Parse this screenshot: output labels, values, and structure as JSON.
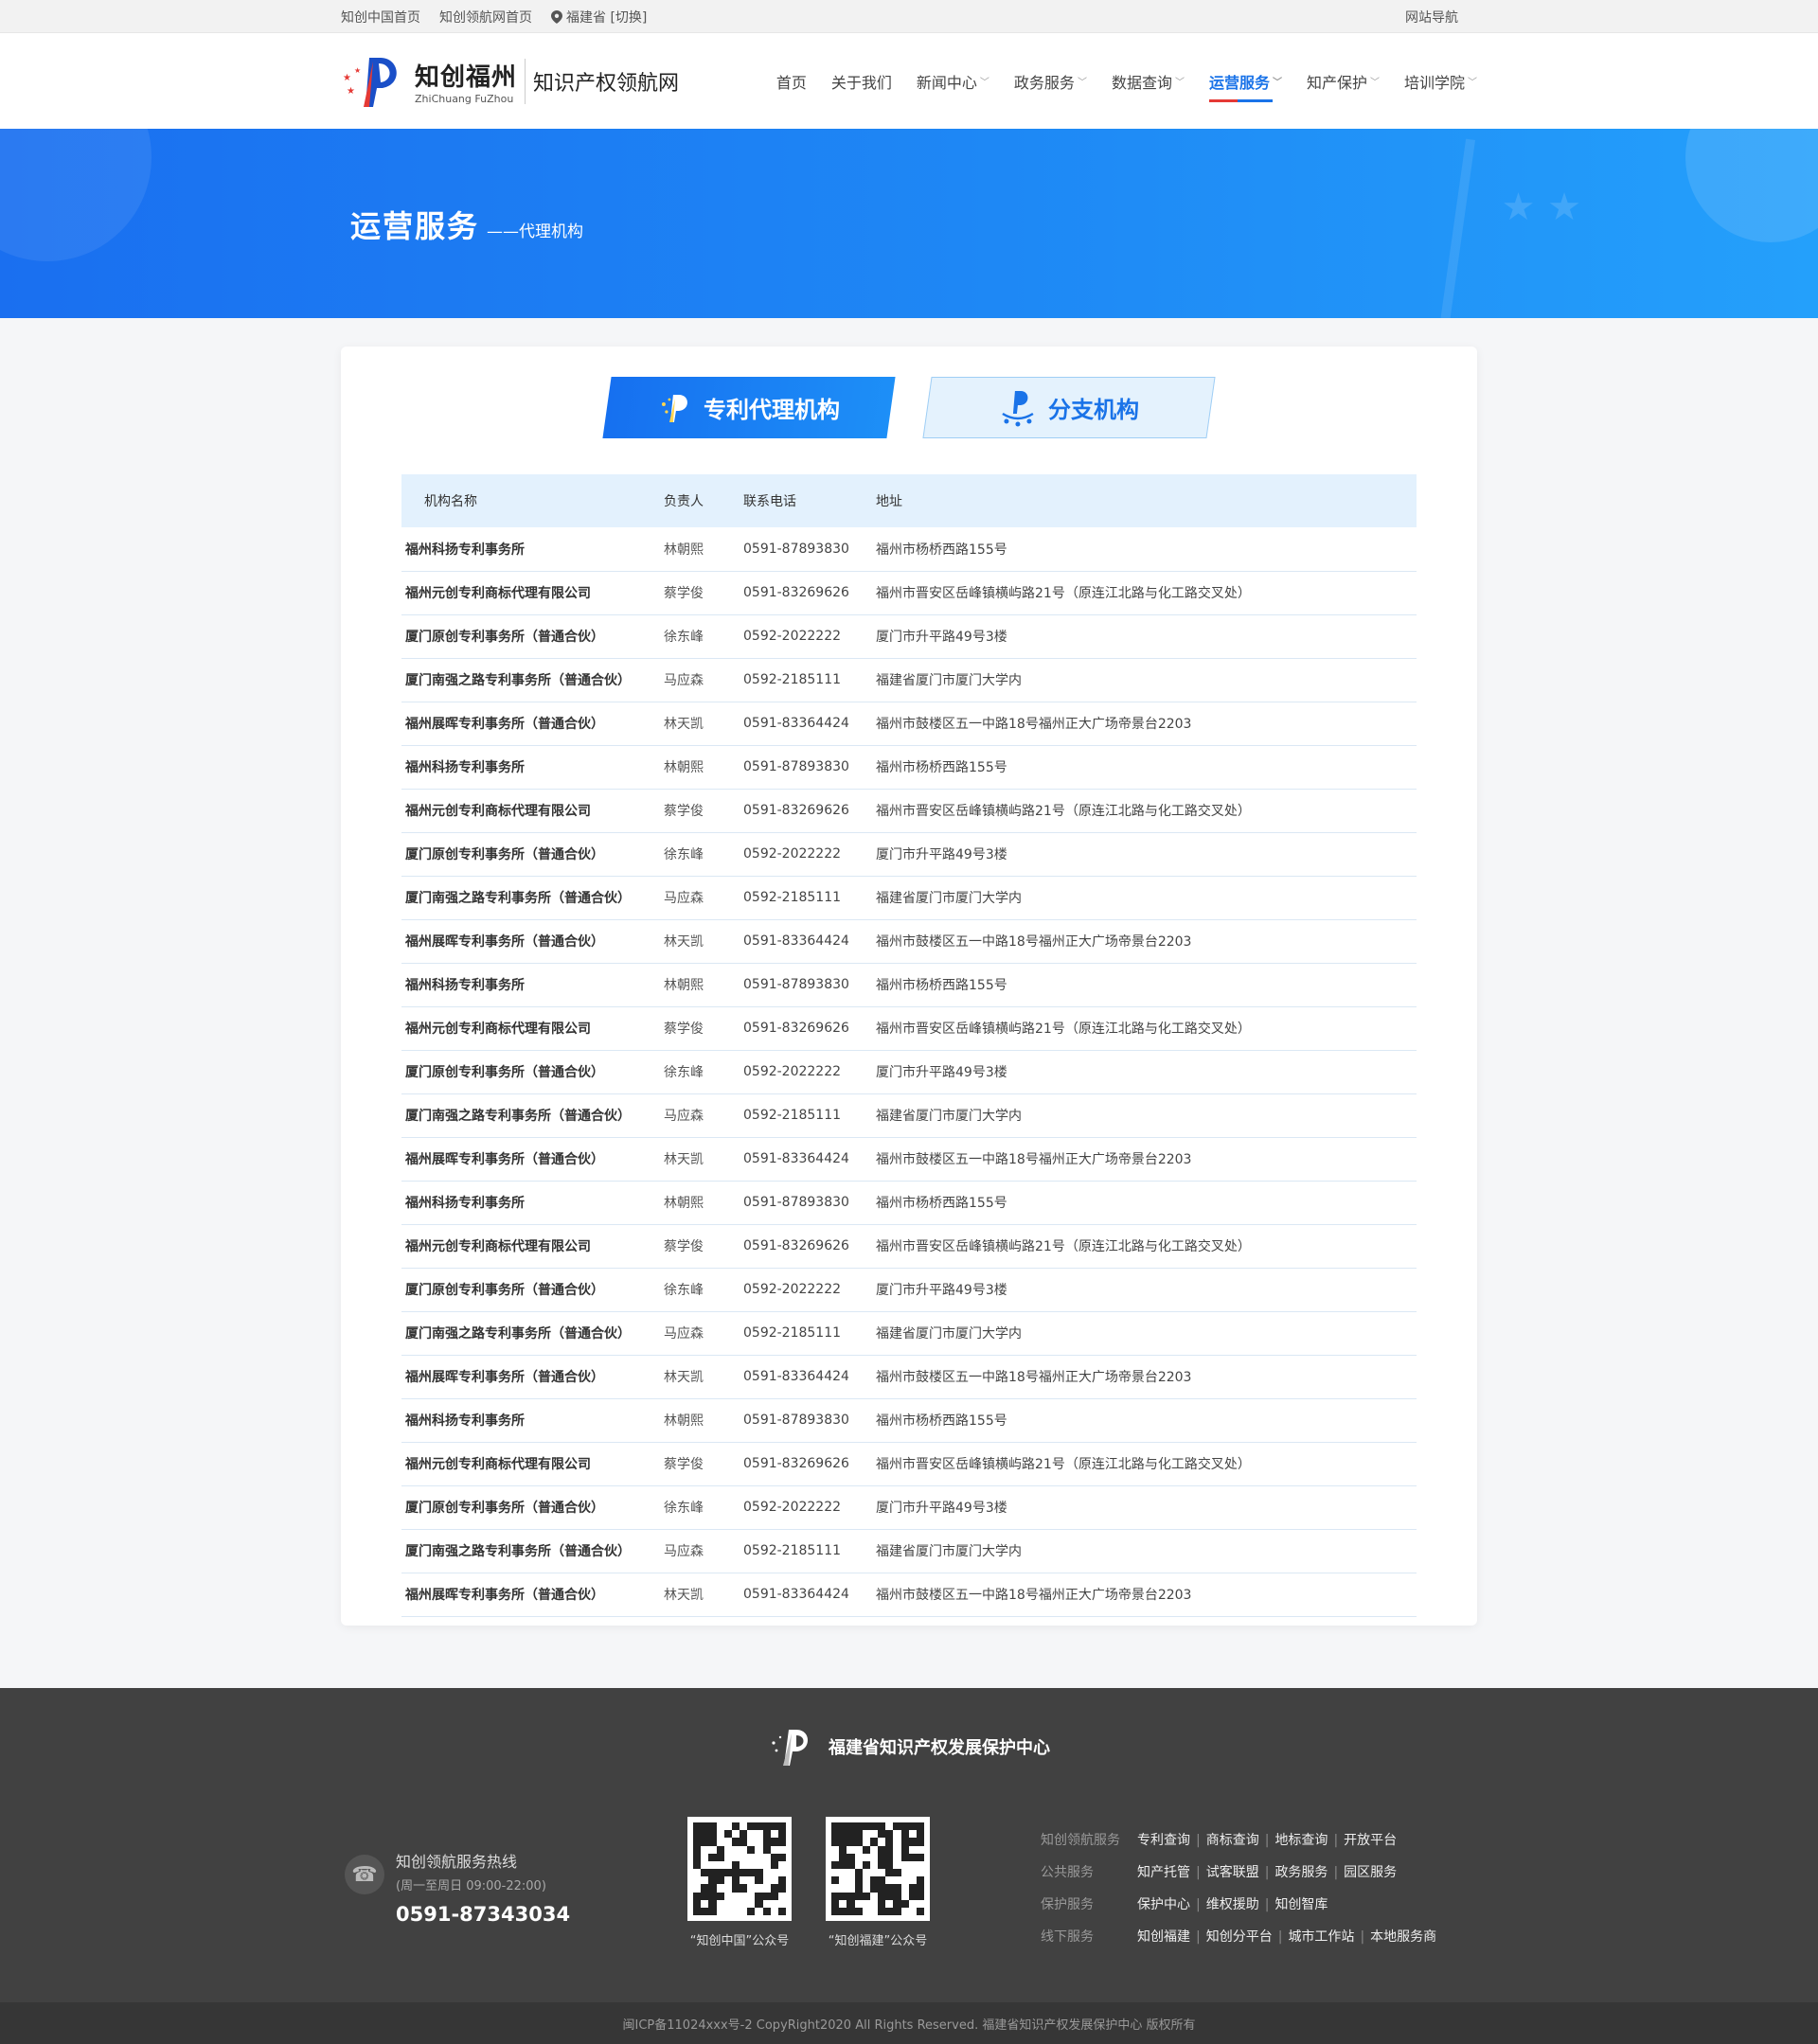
{
  "topbar": {
    "link1": "知创中国首页",
    "link2": "知创领航网首页",
    "location": "福建省 [切换]",
    "site_nav": "网站导航"
  },
  "header": {
    "logo_cn": "知创福州",
    "logo_en": "ZhiChuang FuZhou",
    "logo_sub": "知识产权领航网",
    "nav": [
      {
        "label": "首页",
        "dropdown": false,
        "active": false
      },
      {
        "label": "关于我们",
        "dropdown": false,
        "active": false
      },
      {
        "label": "新闻中心",
        "dropdown": true,
        "active": false
      },
      {
        "label": "政务服务",
        "dropdown": true,
        "active": false
      },
      {
        "label": "数据查询",
        "dropdown": true,
        "active": false
      },
      {
        "label": "运营服务",
        "dropdown": true,
        "active": true
      },
      {
        "label": "知产保护",
        "dropdown": true,
        "active": false
      },
      {
        "label": "培训学院",
        "dropdown": true,
        "active": false
      }
    ]
  },
  "banner": {
    "title": "运营服务",
    "subtitle": "——代理机构"
  },
  "tabs": {
    "patent": "专利代理机构",
    "branch": "分支机构"
  },
  "table": {
    "headers": [
      "机构名称",
      "负责人",
      "联系电话",
      "地址"
    ],
    "rows": [
      [
        "福州科扬专利事务所",
        "林朝熙",
        "0591-87893830",
        "福州市杨桥西路155号"
      ],
      [
        "福州元创专利商标代理有限公司",
        "蔡学俊",
        "0591-83269626",
        "福州市晋安区岳峰镇横屿路21号（原连江北路与化工路交叉处）"
      ],
      [
        "厦门原创专利事务所（普通合伙）",
        "徐东峰",
        "0592-2022222",
        "厦门市升平路49号3楼"
      ],
      [
        "厦门南强之路专利事务所（普通合伙）",
        "马应森",
        "0592-2185111",
        "福建省厦门市厦门大学内"
      ],
      [
        "福州展晖专利事务所（普通合伙）",
        "林天凯",
        "0591-83364424",
        "福州市鼓楼区五一中路18号福州正大广场帝景台2203"
      ],
      [
        "福州科扬专利事务所",
        "林朝熙",
        "0591-87893830",
        "福州市杨桥西路155号"
      ],
      [
        "福州元创专利商标代理有限公司",
        "蔡学俊",
        "0591-83269626",
        "福州市晋安区岳峰镇横屿路21号（原连江北路与化工路交叉处）"
      ],
      [
        "厦门原创专利事务所（普通合伙）",
        "徐东峰",
        "0592-2022222",
        "厦门市升平路49号3楼"
      ],
      [
        "厦门南强之路专利事务所（普通合伙）",
        "马应森",
        "0592-2185111",
        "福建省厦门市厦门大学内"
      ],
      [
        "福州展晖专利事务所（普通合伙）",
        "林天凯",
        "0591-83364424",
        "福州市鼓楼区五一中路18号福州正大广场帝景台2203"
      ],
      [
        "福州科扬专利事务所",
        "林朝熙",
        "0591-87893830",
        "福州市杨桥西路155号"
      ],
      [
        "福州元创专利商标代理有限公司",
        "蔡学俊",
        "0591-83269626",
        "福州市晋安区岳峰镇横屿路21号（原连江北路与化工路交叉处）"
      ],
      [
        "厦门原创专利事务所（普通合伙）",
        "徐东峰",
        "0592-2022222",
        "厦门市升平路49号3楼"
      ],
      [
        "厦门南强之路专利事务所（普通合伙）",
        "马应森",
        "0592-2185111",
        "福建省厦门市厦门大学内"
      ],
      [
        "福州展晖专利事务所（普通合伙）",
        "林天凯",
        "0591-83364424",
        "福州市鼓楼区五一中路18号福州正大广场帝景台2203"
      ],
      [
        "福州科扬专利事务所",
        "林朝熙",
        "0591-87893830",
        "福州市杨桥西路155号"
      ],
      [
        "福州元创专利商标代理有限公司",
        "蔡学俊",
        "0591-83269626",
        "福州市晋安区岳峰镇横屿路21号（原连江北路与化工路交叉处）"
      ],
      [
        "厦门原创专利事务所（普通合伙）",
        "徐东峰",
        "0592-2022222",
        "厦门市升平路49号3楼"
      ],
      [
        "厦门南强之路专利事务所（普通合伙）",
        "马应森",
        "0592-2185111",
        "福建省厦门市厦门大学内"
      ],
      [
        "福州展晖专利事务所（普通合伙）",
        "林天凯",
        "0591-83364424",
        "福州市鼓楼区五一中路18号福州正大广场帝景台2203"
      ],
      [
        "福州科扬专利事务所",
        "林朝熙",
        "0591-87893830",
        "福州市杨桥西路155号"
      ],
      [
        "福州元创专利商标代理有限公司",
        "蔡学俊",
        "0591-83269626",
        "福州市晋安区岳峰镇横屿路21号（原连江北路与化工路交叉处）"
      ],
      [
        "厦门原创专利事务所（普通合伙）",
        "徐东峰",
        "0592-2022222",
        "厦门市升平路49号3楼"
      ],
      [
        "厦门南强之路专利事务所（普通合伙）",
        "马应森",
        "0592-2185111",
        "福建省厦门市厦门大学内"
      ],
      [
        "福州展晖专利事务所（普通合伙）",
        "林天凯",
        "0591-83364424",
        "福州市鼓楼区五一中路18号福州正大广场帝景台2203"
      ]
    ]
  },
  "footer": {
    "brand": "福建省知识产权发展保护中心",
    "hotline_title": "知创领航服务热线",
    "hotline_hours": "(周一至周日 09:00-22:00)",
    "hotline_number": "0591-87343034",
    "qr1_caption": "“知创中国”公众号",
    "qr2_caption": "“知创福建”公众号",
    "link_rows": [
      {
        "category": "知创领航服务",
        "items": [
          "专利查询",
          "商标查询",
          "地标查询",
          "开放平台"
        ]
      },
      {
        "category": "公共服务",
        "items": [
          "知产托管",
          "试客联盟",
          "政务服务",
          "园区服务"
        ]
      },
      {
        "category": "保护服务",
        "items": [
          "保护中心",
          "维权援助",
          "知创智库"
        ]
      },
      {
        "category": "线下服务",
        "items": [
          "知创福建",
          "知创分平台",
          "城市工作站",
          "本地服务商"
        ]
      }
    ],
    "copyright": "闽ICP备11024xxx号-2  CopyRight2020  All Rights Reserved.  福建省知识产权发展保护中心  版权所有"
  },
  "colors": {
    "accent": "#1a73e8",
    "banner_start": "#1a6ff0",
    "banner_end": "#24a0fb",
    "table_header_bg": "#e3f1fd",
    "footer_bg": "#414141",
    "copyright_bg": "#363636"
  }
}
